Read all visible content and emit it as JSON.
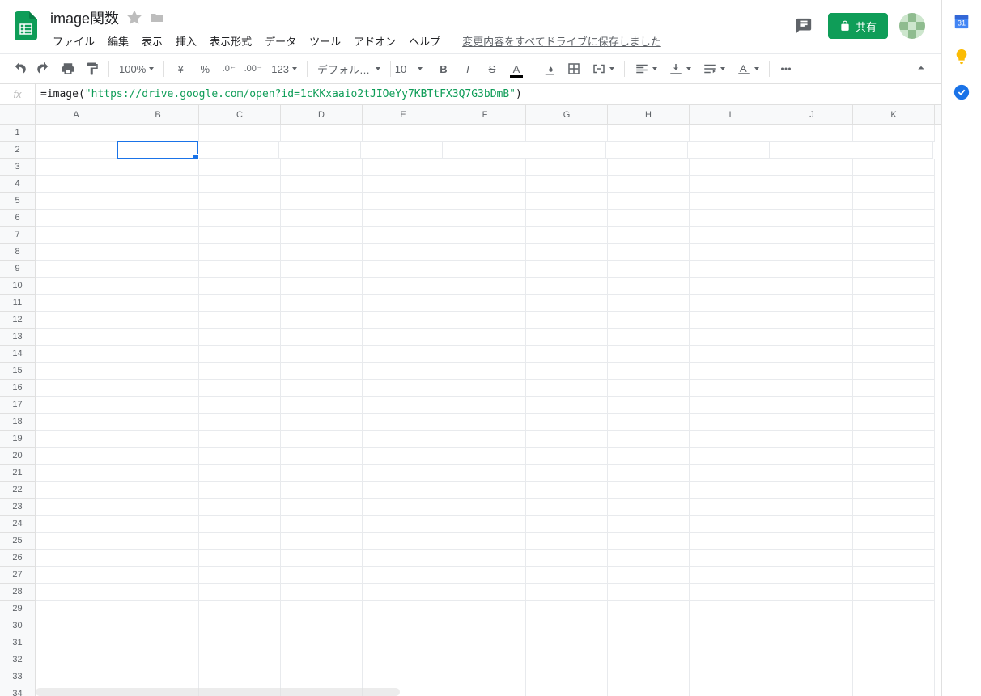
{
  "header": {
    "doc_title": "image関数",
    "save_status": "変更内容をすべてドライブに保存しました",
    "share_label": "共有"
  },
  "menu": {
    "file": "ファイル",
    "edit": "編集",
    "view": "表示",
    "insert": "挿入",
    "format": "表示形式",
    "data": "データ",
    "tools": "ツール",
    "addons": "アドオン",
    "help": "ヘルプ"
  },
  "toolbar": {
    "zoom": "100%",
    "currency": "¥",
    "percent": "%",
    "dec_dec": ".0",
    "dec_inc": ".00",
    "more_formats": "123",
    "font": "デフォルト…",
    "font_size": "10"
  },
  "formula_bar": {
    "fx": "fx",
    "prefix": "=image(",
    "string": "\"https://drive.google.com/open?id=1cKKxaaio2tJIOeYy7KBTtFX3Q7G3bDmB\"",
    "suffix": ")"
  },
  "grid": {
    "columns": [
      "A",
      "B",
      "C",
      "D",
      "E",
      "F",
      "G",
      "H",
      "I",
      "J",
      "K"
    ],
    "row_count": 34,
    "selected_cell": {
      "row": 2,
      "col": "B"
    }
  },
  "sidebar": {
    "calendar": "31"
  }
}
